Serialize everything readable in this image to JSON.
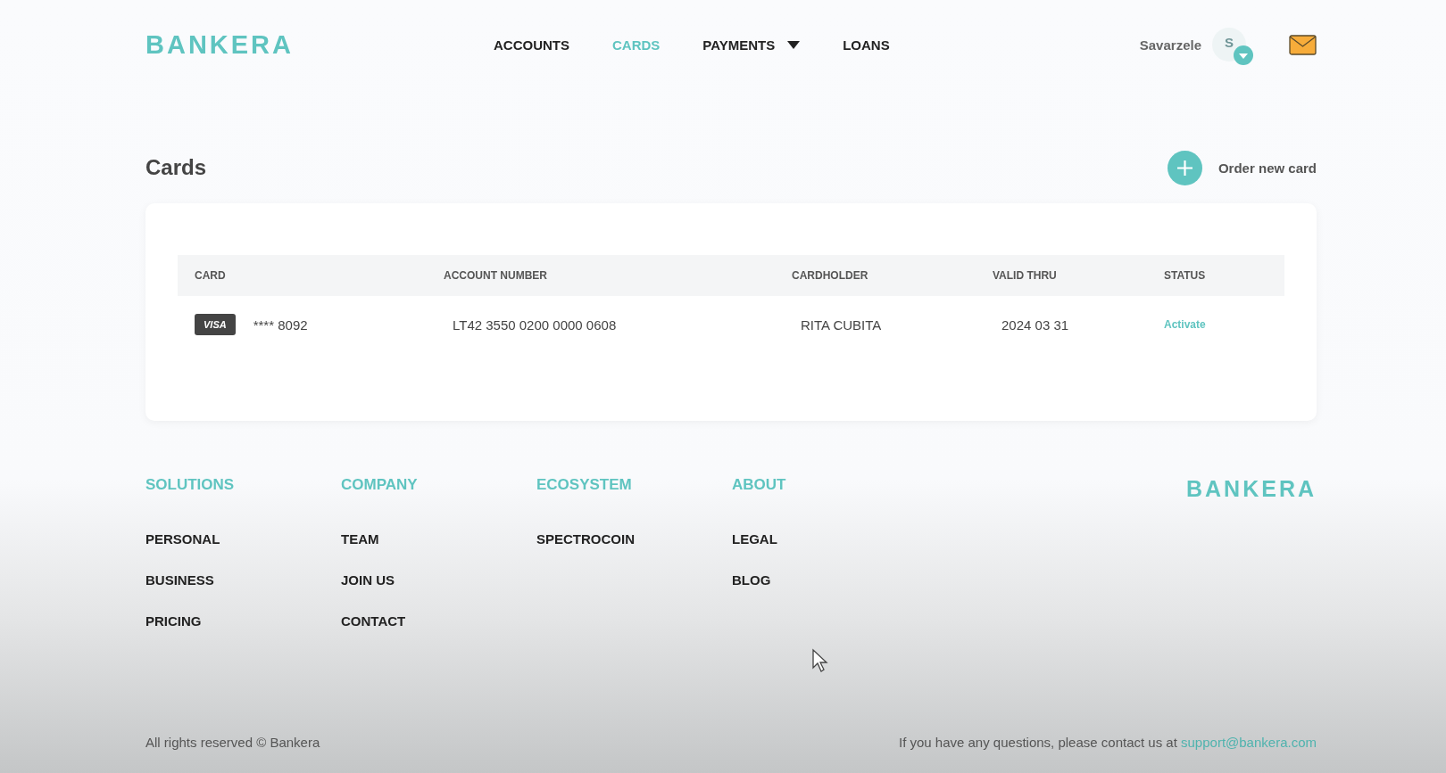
{
  "header": {
    "logo": "BANKERA",
    "nav": [
      {
        "label": "ACCOUNTS",
        "selected": false,
        "dropdown": false
      },
      {
        "label": "CARDS",
        "selected": true,
        "dropdown": false
      },
      {
        "label": "PAYMENTS",
        "selected": false,
        "dropdown": true
      },
      {
        "label": "LOANS",
        "selected": false,
        "dropdown": false
      }
    ],
    "user": {
      "name": "Savarzele",
      "avatar_initial": "S"
    }
  },
  "page": {
    "title": "Cards",
    "order_button": "Order new card"
  },
  "table": {
    "columns": [
      "CARD",
      "ACCOUNT NUMBER",
      "CARDHOLDER",
      "VALID THRU",
      "STATUS"
    ],
    "rows": [
      {
        "brand": "VISA",
        "card_number": "**** 8092",
        "account_number": "LT42 3550 0200 0000 0608",
        "cardholder": "RITA CUBITA",
        "valid_thru": "2024 03 31",
        "status": "Activate"
      }
    ]
  },
  "footer": {
    "columns": [
      {
        "heading": "SOLUTIONS",
        "links": [
          "PERSONAL",
          "BUSINESS",
          "PRICING"
        ]
      },
      {
        "heading": "COMPANY",
        "links": [
          "TEAM",
          "JOIN US",
          "CONTACT"
        ]
      },
      {
        "heading": "ECOSYSTEM",
        "links": [
          "SPECTROCOIN"
        ]
      },
      {
        "heading": "ABOUT",
        "links": [
          "LEGAL",
          "BLOG"
        ]
      }
    ],
    "logo": "BANKERA",
    "copyright": "All rights reserved © Bankera",
    "contact_text": "If you have any questions, please contact us at",
    "contact_email": "support@bankera.com"
  }
}
